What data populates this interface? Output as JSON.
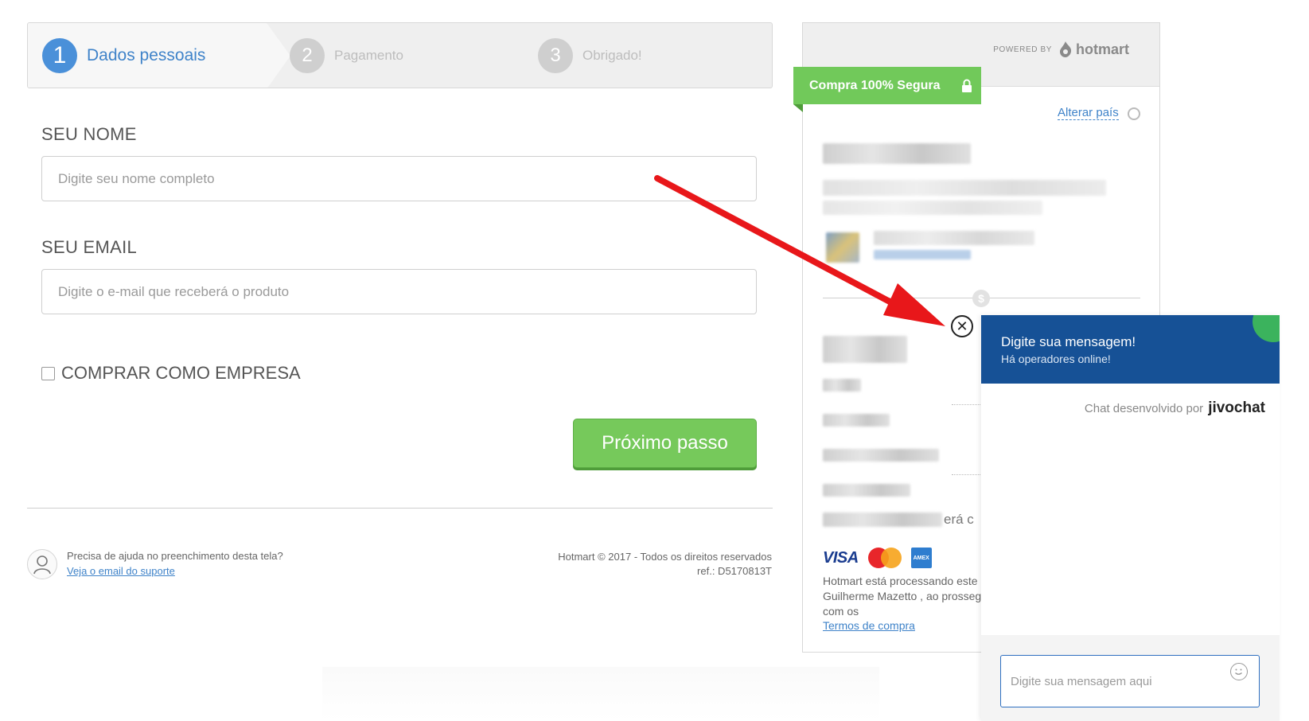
{
  "steps": [
    {
      "number": "1",
      "label": "Dados pessoais"
    },
    {
      "number": "2",
      "label": "Pagamento"
    },
    {
      "number": "3",
      "label": "Obrigado!"
    }
  ],
  "form": {
    "name_label": "SEU NOME",
    "name_placeholder": "Digite seu nome completo",
    "email_label": "SEU EMAIL",
    "email_placeholder": "Digite o e-mail que receberá o produto",
    "company_label": "COMPRAR COMO EMPRESA",
    "next_button": "Próximo passo"
  },
  "footer": {
    "help_text": "Precisa de ajuda no preenchimento desta tela?",
    "help_link": "Veja o email do suporte",
    "copyright": "Hotmart © 2017 - Todos os direitos reservados",
    "ref": "ref.: D5170813T"
  },
  "side": {
    "powered_by": "POWERED BY",
    "brand": "hotmart",
    "secure_badge": "Compra 100% Segura",
    "change_country": "Alterar país",
    "partial_text": "erá c",
    "card_visa": "VISA",
    "processing_line1": "Hotmart está processando este",
    "processing_line2": "Guilherme Mazetto , ao prosseg",
    "processing_line3": "com os",
    "terms_link": "Termos de compra"
  },
  "chat": {
    "title": "Digite sua mensagem!",
    "subtitle": "Há operadores online!",
    "developed_by": "Chat desenvolvido por",
    "brand": "jivochat",
    "input_placeholder": "Digite sua mensagem aqui",
    "close_symbol": "✕"
  },
  "colors": {
    "active_blue": "#4a90d9",
    "green": "#76c95b",
    "chat_header": "#165196",
    "arrow_red": "#e8171a"
  }
}
